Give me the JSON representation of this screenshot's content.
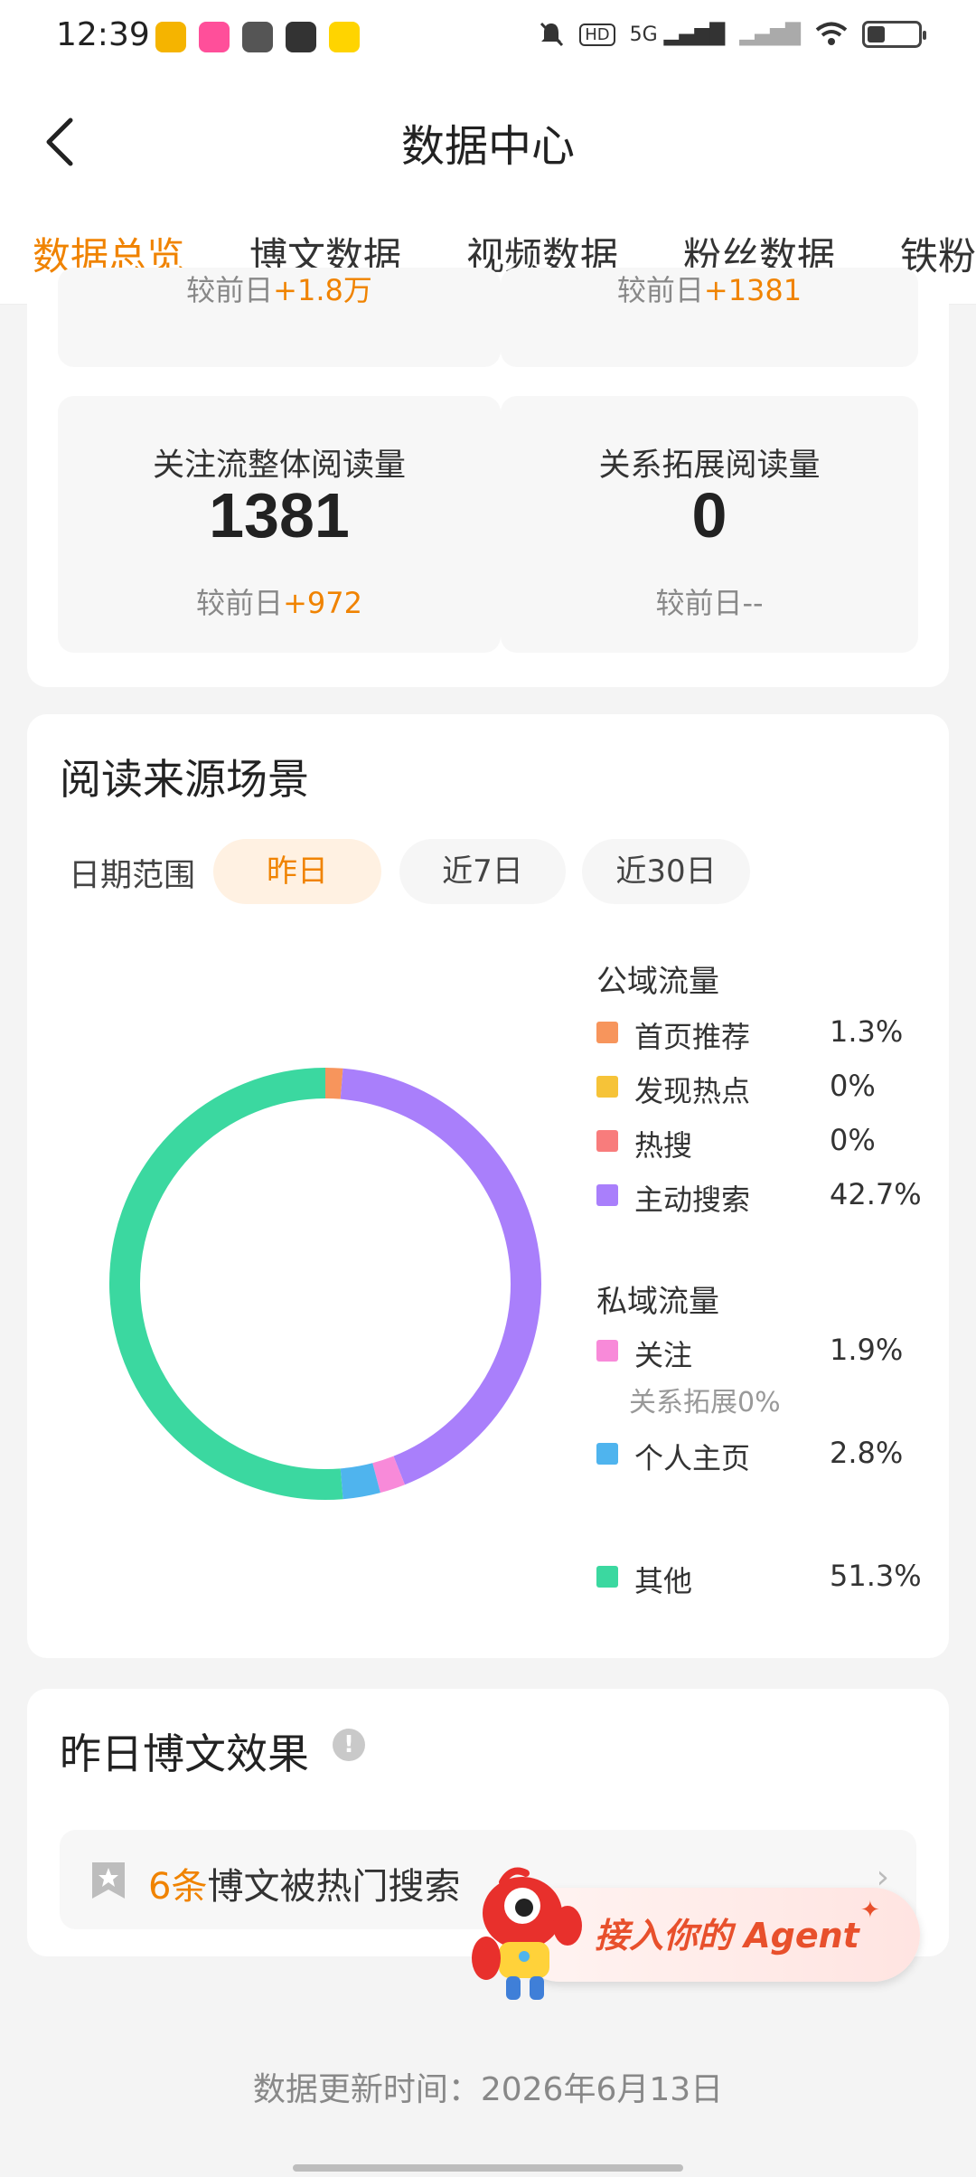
{
  "status_bar": {
    "time": "12:39",
    "network": "5G"
  },
  "header": {
    "title": "数据中心"
  },
  "tabs": [
    {
      "label": "数据总览"
    },
    {
      "label": "博文数据"
    },
    {
      "label": "视频数据"
    },
    {
      "label": "粉丝数据"
    },
    {
      "label": "铁粉"
    }
  ],
  "top_partial": {
    "left_delta_prefix": "较前日",
    "left_delta_value": "+1.8万",
    "right_delta_prefix": "较前日",
    "right_delta_value": "+1381"
  },
  "stats": [
    {
      "label": "关注流整体阅读量",
      "value": "1381",
      "delta_prefix": "较前日",
      "delta_value": "+972"
    },
    {
      "label": "关系拓展阅读量",
      "value": "0",
      "delta_prefix": "较前日",
      "delta_value": "--"
    }
  ],
  "reading_source": {
    "title": "阅读来源场景",
    "date_range_label": "日期范围",
    "ranges": [
      "昨日",
      "近7日",
      "近30日"
    ],
    "selected_range": "昨日",
    "public_group": "公域流量",
    "private_group": "私域流量",
    "sub_note": "关系拓展0%"
  },
  "chart_data": {
    "type": "pie",
    "donut": true,
    "series": [
      {
        "name": "首页推荐",
        "value": 1.3,
        "label": "1.3%",
        "color": "#f7955c"
      },
      {
        "name": "发现热点",
        "value": 0,
        "label": "0%",
        "color": "#f6c338"
      },
      {
        "name": "热搜",
        "value": 0,
        "label": "0%",
        "color": "#f87c7c"
      },
      {
        "name": "主动搜索",
        "value": 42.7,
        "label": "42.7%",
        "color": "#a97ffb"
      },
      {
        "name": "关注",
        "value": 1.9,
        "label": "1.9%",
        "color": "#f88ad9"
      },
      {
        "name": "个人主页",
        "value": 2.8,
        "label": "2.8%",
        "color": "#4fb4ee"
      },
      {
        "name": "其他",
        "value": 51.3,
        "label": "51.3%",
        "color": "#3bd8a0"
      }
    ]
  },
  "yesterday_posts": {
    "title": "昨日博文效果",
    "count": "6条",
    "text": "博文被热门搜索"
  },
  "agent_banner": {
    "label": "接入你的 Agent"
  },
  "footer": {
    "update_text": "数据更新时间：2026年6月13日"
  },
  "colors": {
    "accent": "#f08300"
  }
}
